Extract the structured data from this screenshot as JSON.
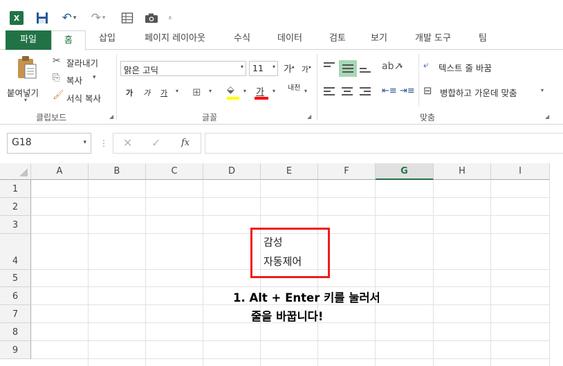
{
  "quick_access": {
    "excel_icon": "excel-icon",
    "save_icon": "save-icon",
    "undo_icon": "undo-icon",
    "redo_icon": "redo-icon",
    "form_icon": "form-icon",
    "camera_icon": "camera-icon"
  },
  "tabs": [
    {
      "label": "파일"
    },
    {
      "label": "홈"
    },
    {
      "label": "삽입"
    },
    {
      "label": "페이지 레이아웃"
    },
    {
      "label": "수식"
    },
    {
      "label": "데이터"
    },
    {
      "label": "검토"
    },
    {
      "label": "보기"
    },
    {
      "label": "개발 도구"
    },
    {
      "label": "팀"
    }
  ],
  "ribbon": {
    "clipboard": {
      "paste": "붙여넣기",
      "cut": "잘라내기",
      "copy": "복사",
      "format_painter": "서식 복사",
      "group_label": "클립보드"
    },
    "font": {
      "name": "맑은 고딕",
      "size": "11",
      "grow": "가",
      "shrink": "가",
      "bold": "가",
      "italic": "가",
      "underline": "가",
      "font_color": "가",
      "phonetic": "내천",
      "group_label": "글꼴"
    },
    "alignment": {
      "wrap_text": "텍스트 줄 바꿈",
      "merge_center": "병합하고 가운데 맞춤",
      "group_label": "맞춤"
    }
  },
  "formula_bar": {
    "name_box": "G18",
    "fx": "fx",
    "formula": ""
  },
  "columns": [
    "A",
    "B",
    "C",
    "D",
    "E",
    "F",
    "G",
    "H",
    "I"
  ],
  "selected_column": "G",
  "rows": [
    "1",
    "2",
    "3",
    "4",
    "5",
    "6",
    "7",
    "8",
    "9"
  ],
  "cell_e4": {
    "line1": "감성",
    "line2": "자동제어"
  },
  "annotation": {
    "line1": "1. Alt + Enter 키를 눌러서",
    "line2": "줄을 바꿉니다!"
  },
  "colors": {
    "excel_green": "#217346",
    "highlight_red": "#ee1c1c"
  }
}
